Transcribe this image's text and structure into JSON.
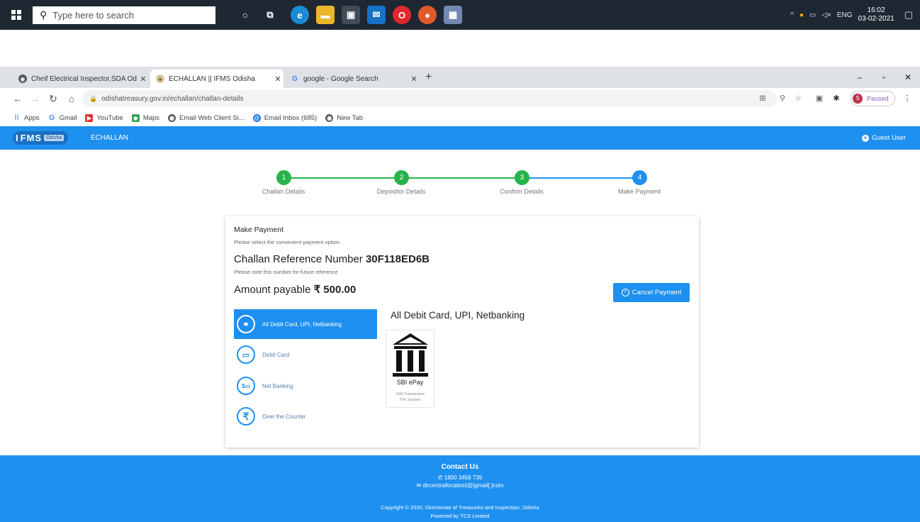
{
  "taskbar": {
    "search_placeholder": "Type here to search",
    "tray_lang": "ENG",
    "time": "16:02",
    "date": "03-02-2021"
  },
  "browser": {
    "tabs": [
      {
        "label": "Cheif Electrical Inspector,SDA Od",
        "active": false
      },
      {
        "label": "ECHALLAN || IFMS Odisha",
        "active": true
      },
      {
        "label": "google - Google Search",
        "active": false
      }
    ],
    "url": "odishatreasury.gov.in/echallan/challan-details",
    "profile_status": "Paused",
    "profile_initial": "S",
    "bookmarks": [
      "Apps",
      "Gmail",
      "YouTube",
      "Maps",
      "Email Web Client Si...",
      "Email Inbox (685)",
      "New Tab"
    ]
  },
  "header": {
    "logo_i": "I",
    "logo_fms": "FMS",
    "logo_tag": "Odisha",
    "app_name": "ECHALLAN",
    "user": "Guest User"
  },
  "stepper": {
    "steps": [
      {
        "num": "1",
        "label": "Challan Details",
        "status": "done"
      },
      {
        "num": "2",
        "label": "Depositor Details",
        "status": "done"
      },
      {
        "num": "3",
        "label": "Confirm Details",
        "status": "done"
      },
      {
        "num": "4",
        "label": "Make Payment",
        "status": "current"
      }
    ],
    "colors": {
      "done": "#25b34a",
      "current": "#1e90ef"
    }
  },
  "payment": {
    "title": "Make Payment",
    "subtitle": "Please select the convenient payment option.",
    "ref_label": "Challan Reference Number",
    "ref_number": "30F118ED6B",
    "ref_note": "Please note this number for future reference",
    "amount_label": "Amount payable",
    "amount": "₹ 500.00",
    "cancel_label": "Cancel Payment",
    "options": [
      {
        "label": "All Debit Card, UPI, Netbanking",
        "icon": "handshake-icon",
        "active": true
      },
      {
        "label": "Debit Card",
        "icon": "card-icon",
        "active": false
      },
      {
        "label": "Net Banking",
        "icon": "netbanking-icon",
        "active": false
      },
      {
        "label": "Over the Counter",
        "icon": "rupee-icon",
        "active": false
      }
    ],
    "selected_title": "All Debit Card, UPI, Netbanking",
    "gateway": {
      "name": "SBI ePay",
      "meta1": "1053 Transactions",
      "meta2": "76% Success"
    }
  },
  "footer": {
    "title": "Contact Us",
    "phone": "1800 3456 739",
    "email": "dircentrallocation[@]gmail[.]com",
    "copyright": "Copyright © 2020, Directorate of Treasuries and Inspection, Odisha",
    "powered": "Powered by TCS Limited"
  },
  "colors": {
    "brand": "#1e90ef",
    "step_done": "#25b34a"
  }
}
